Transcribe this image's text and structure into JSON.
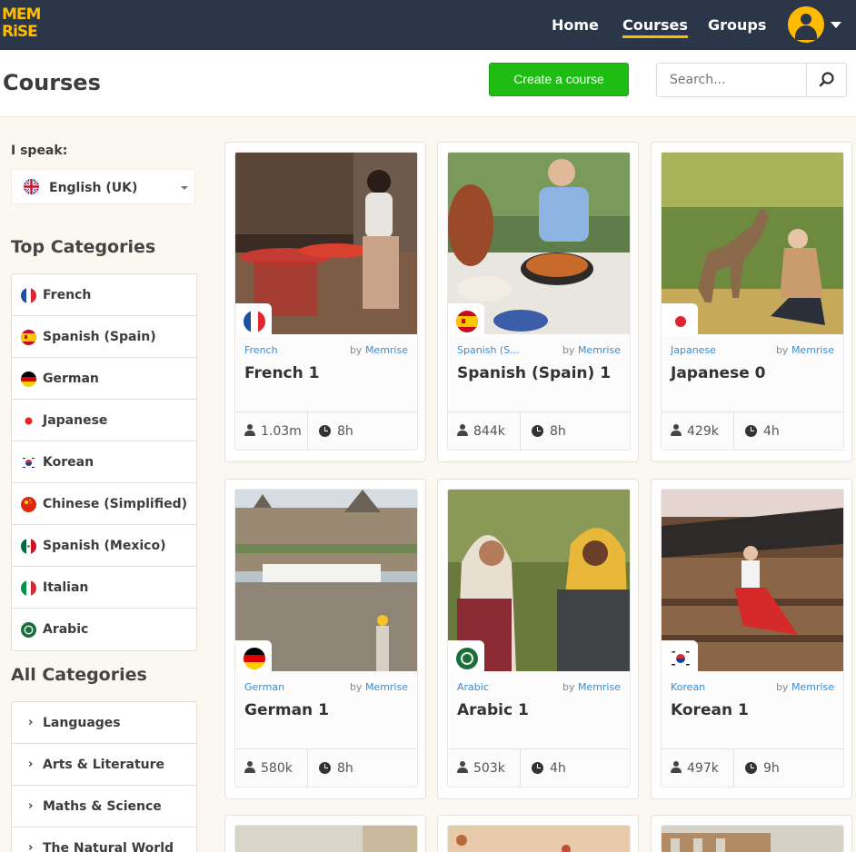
{
  "nav": {
    "logo": "MEM RiSE",
    "logo_line1": "MEM",
    "logo_line2": "RiSE",
    "home": "Home",
    "courses": "Courses",
    "groups": "Groups"
  },
  "header": {
    "title": "Courses",
    "create": "Create a course",
    "search_placeholder": "Search..."
  },
  "sidebar": {
    "speak_label": "I speak:",
    "speak_value": "English (UK)",
    "top_title": "Top Categories",
    "top": [
      "French",
      "Spanish (Spain)",
      "German",
      "Japanese",
      "Korean",
      "Chinese (Simplified)",
      "Spanish (Mexico)",
      "Italian",
      "Arabic"
    ],
    "all_title": "All Categories",
    "all": [
      "Languages",
      "Arts & Literature",
      "Maths & Science",
      "The Natural World"
    ]
  },
  "cards": [
    {
      "category": "French",
      "by": "by",
      "author": "Memrise",
      "title": "French 1",
      "learners": "1.03m",
      "time": "8h"
    },
    {
      "category": "Spanish (S...",
      "by": "by",
      "author": "Memrise",
      "title": "Spanish (Spain) 1",
      "learners": "844k",
      "time": "8h"
    },
    {
      "category": "Japanese",
      "by": "by",
      "author": "Memrise",
      "title": "Japanese 0",
      "learners": "429k",
      "time": "4h"
    },
    {
      "category": "German",
      "by": "by",
      "author": "Memrise",
      "title": "German 1",
      "learners": "580k",
      "time": "8h"
    },
    {
      "category": "Arabic",
      "by": "by",
      "author": "Memrise",
      "title": "Arabic 1",
      "learners": "503k",
      "time": "4h"
    },
    {
      "category": "Korean",
      "by": "by",
      "author": "Memrise",
      "title": "Korean 1",
      "learners": "497k",
      "time": "9h"
    }
  ],
  "colors": {
    "nav_bg": "#2b3648",
    "brand_yellow": "#ffbb00",
    "create_green": "#1fbd14",
    "link_blue": "#3b8ed6",
    "page_bg": "#fbf7f1"
  }
}
